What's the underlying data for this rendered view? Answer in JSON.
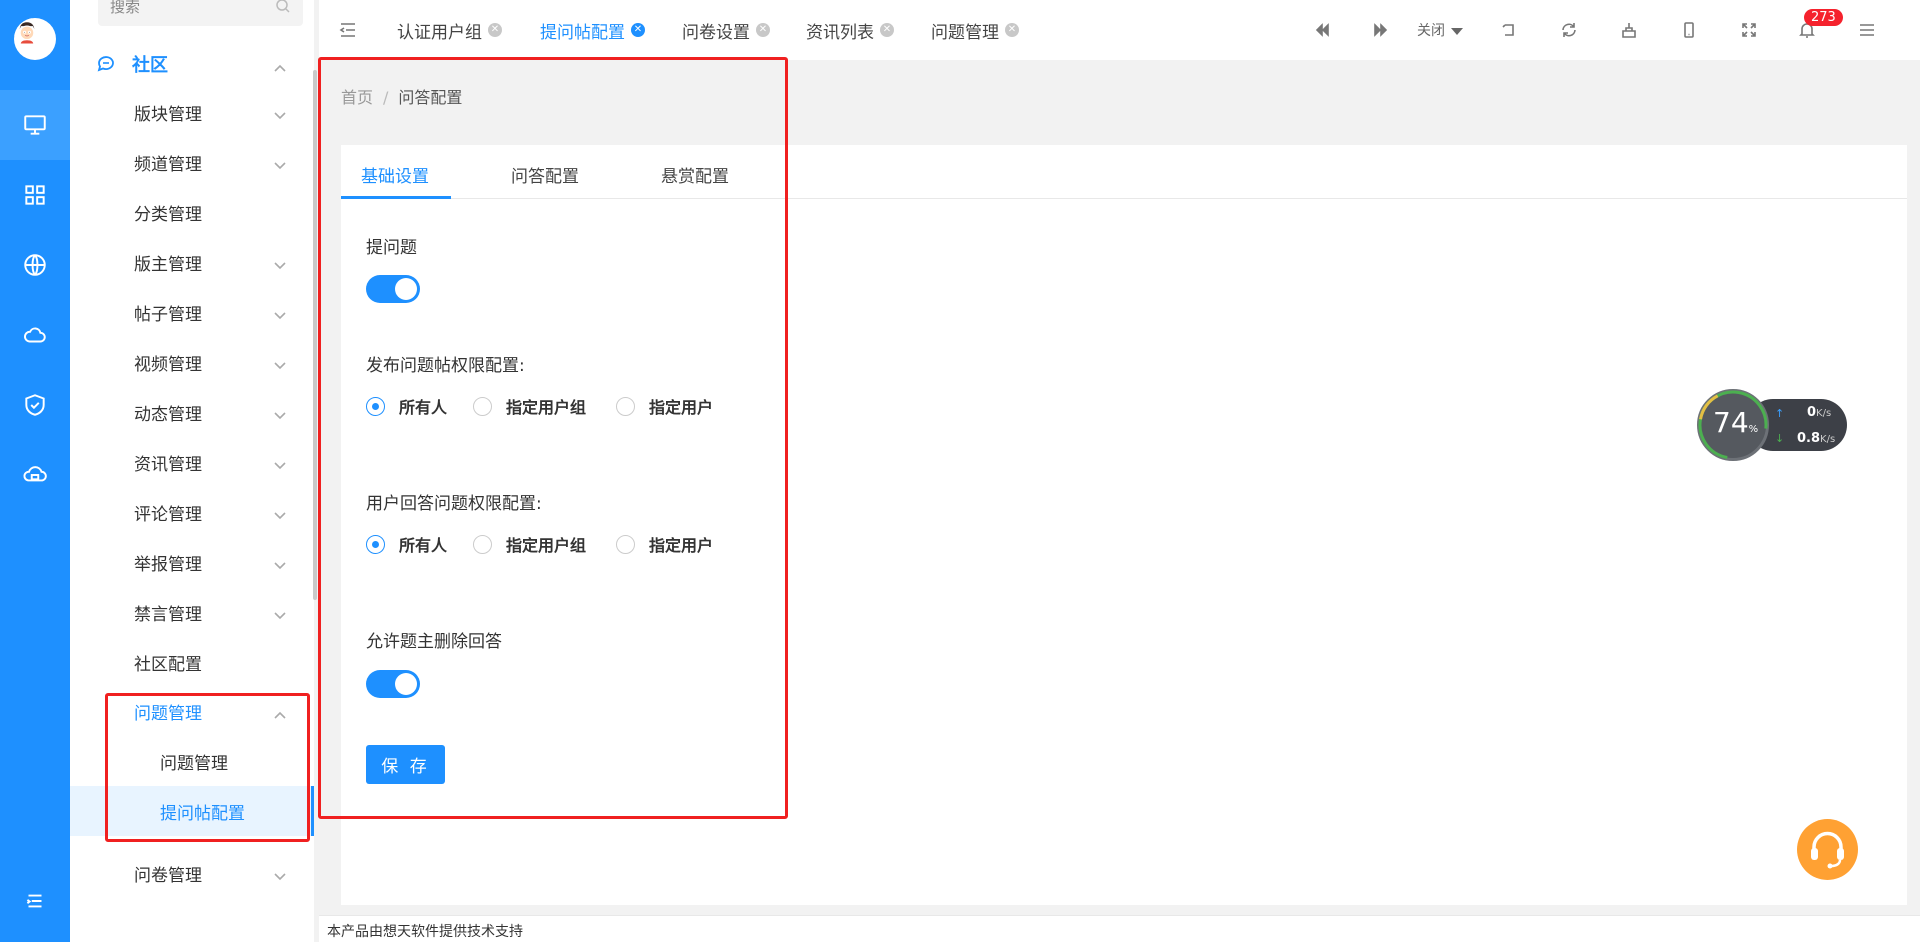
{
  "sidebar": {
    "search_placeholder": "搜索",
    "group_title": "社区",
    "items": [
      {
        "label": "版块管理",
        "chevron": true
      },
      {
        "label": "频道管理",
        "chevron": true
      },
      {
        "label": "分类管理",
        "chevron": false
      },
      {
        "label": "版主管理",
        "chevron": true
      },
      {
        "label": "帖子管理",
        "chevron": true
      },
      {
        "label": "视频管理",
        "chevron": true
      },
      {
        "label": "动态管理",
        "chevron": true
      },
      {
        "label": "资讯管理",
        "chevron": true
      },
      {
        "label": "评论管理",
        "chevron": true
      },
      {
        "label": "举报管理",
        "chevron": true
      },
      {
        "label": "禁言管理",
        "chevron": true
      },
      {
        "label": "社区配置",
        "chevron": false
      }
    ],
    "open_item": "问题管理",
    "sub_items": [
      "问题管理",
      "提问帖配置"
    ],
    "after_item": "问卷管理"
  },
  "topbar": {
    "tabs": [
      {
        "label": "认证用户组",
        "active": false
      },
      {
        "label": "提问帖配置",
        "active": true
      },
      {
        "label": "问卷设置",
        "active": false
      },
      {
        "label": "资讯列表",
        "active": false
      },
      {
        "label": "问题管理",
        "active": false
      }
    ],
    "close_label": "关闭",
    "notification_count": "273"
  },
  "breadcrumb": {
    "home": "首页",
    "separator": "/",
    "current": "问答配置"
  },
  "tabs": [
    "基础设置",
    "问答配置",
    "悬赏配置"
  ],
  "form": {
    "ask_label": "提问题",
    "publish_label": "发布问题帖权限配置:",
    "answer_label": "用户回答问题权限配置:",
    "allow_delete_label": "允许题主删除回答",
    "radio_options": [
      "所有人",
      "指定用户组",
      "指定用户"
    ],
    "save_label": "保 存"
  },
  "speed": {
    "percent": "74",
    "percent_unit": "%",
    "up": "0",
    "down": "0.8",
    "unit": "K/s"
  },
  "footer": "本产品由想天软件提供技术支持",
  "colors": {
    "primary": "#1e90ff",
    "highlight": "#f02020",
    "badge": "#f5222d"
  }
}
